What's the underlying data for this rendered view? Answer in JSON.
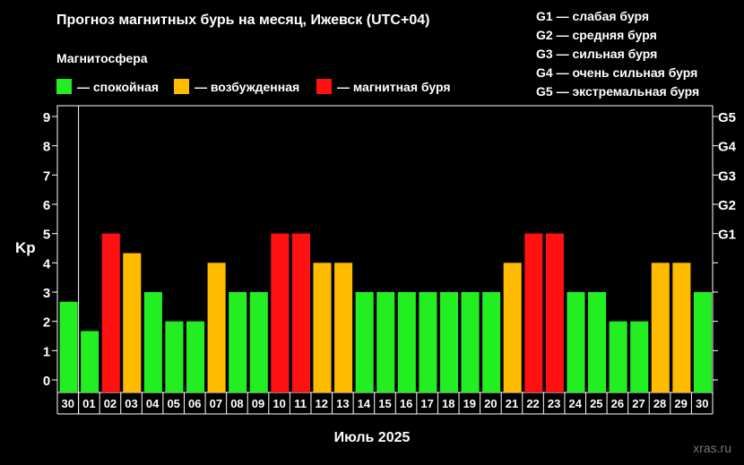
{
  "title": "Прогноз магнитных бурь на месяц, Ижевск (UTC+04)",
  "legend_title": "Магнитосфера",
  "legend": [
    {
      "label": "— спокойная",
      "color": "#22ee22"
    },
    {
      "label": "— возбужденная",
      "color": "#ffbb00"
    },
    {
      "label": "— магнитная буря",
      "color": "#ff1111"
    }
  ],
  "g_scale": [
    "G1 — слабая буря",
    "G2 — средняя буря",
    "G3 — сильная буря",
    "G4 — очень сильная буря",
    "G5 — экстремальная буря"
  ],
  "watermark": "xras.ru",
  "chart_data": {
    "type": "bar",
    "ylabel": "Kp",
    "xlabel": "Июль 2025",
    "ylim": [
      0,
      9
    ],
    "yticks": [
      "0",
      "1",
      "2",
      "3",
      "4",
      "5",
      "6",
      "7",
      "8",
      "9"
    ],
    "right_ticks": [
      {
        "kp": 5,
        "label": "G1"
      },
      {
        "kp": 6,
        "label": "G2"
      },
      {
        "kp": 7,
        "label": "G3"
      },
      {
        "kp": 8,
        "label": "G4"
      },
      {
        "kp": 9,
        "label": "G5"
      }
    ],
    "categories": [
      "30",
      "01",
      "02",
      "03",
      "04",
      "05",
      "06",
      "07",
      "08",
      "09",
      "10",
      "11",
      "12",
      "13",
      "14",
      "15",
      "16",
      "17",
      "18",
      "19",
      "20",
      "21",
      "22",
      "23",
      "24",
      "25",
      "26",
      "27",
      "28",
      "29",
      "30"
    ],
    "values": [
      2.67,
      1.67,
      5,
      4.33,
      3,
      2,
      2,
      4,
      3,
      3,
      5,
      5,
      4,
      4,
      3,
      3,
      3,
      3,
      3,
      3,
      3,
      4,
      5,
      5,
      3,
      3,
      2,
      2,
      4,
      4,
      3
    ],
    "colors": {
      "quiet": "#22ee22",
      "active": "#ffbb00",
      "storm": "#ff1111"
    }
  }
}
